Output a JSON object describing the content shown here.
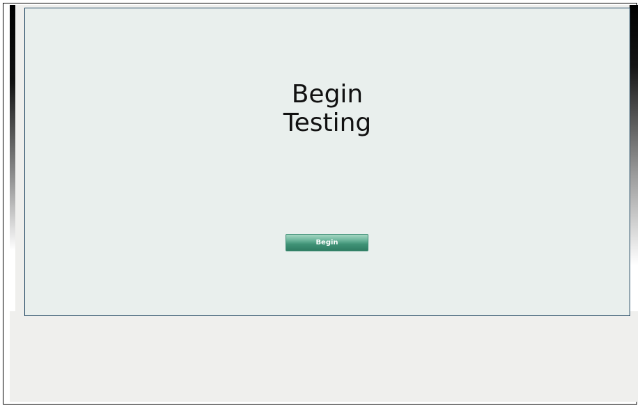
{
  "panel": {
    "heading_line1": "Begin",
    "heading_line2": "Testing",
    "begin_button_label": "Begin"
  },
  "colors": {
    "panel_background": "#e9efed",
    "panel_border": "#1f4560",
    "button_green": "#3f9276",
    "page_background": "#efefed"
  }
}
